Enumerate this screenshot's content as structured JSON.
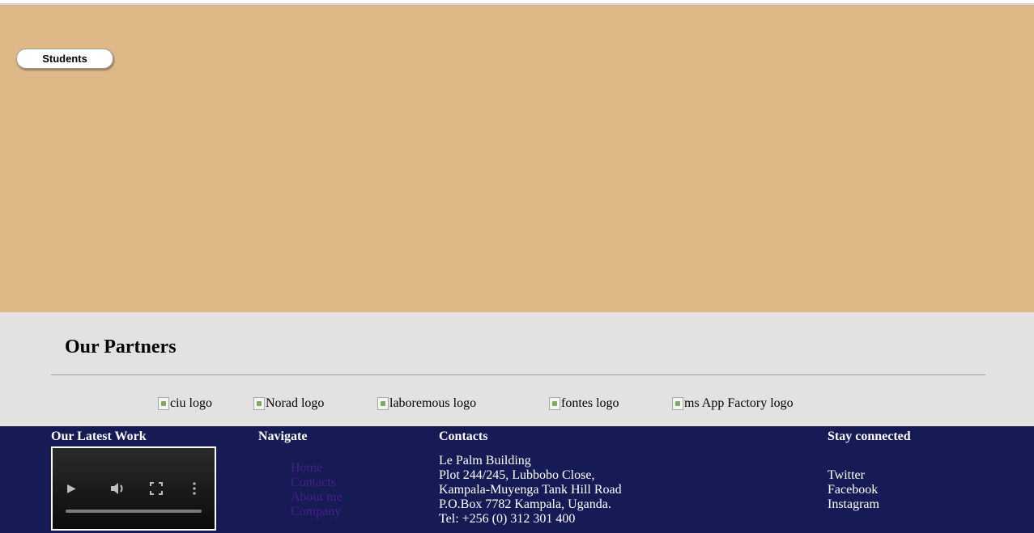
{
  "hero": {
    "students_button": "Students",
    "background_color": "#deb887"
  },
  "partners": {
    "title": "Our Partners",
    "logos": [
      {
        "alt": "ciu logo"
      },
      {
        "alt": "Norad logo"
      },
      {
        "alt": "laboremous logo"
      },
      {
        "alt": "fontes logo"
      },
      {
        "alt": "ms App Factory logo"
      }
    ]
  },
  "footer": {
    "background_color": "#161b56",
    "latest_work": {
      "title": "Our Latest Work"
    },
    "navigate": {
      "title": "Navigate",
      "links": [
        "Home",
        "Contacts",
        "About me",
        "Company"
      ],
      "link_color": "#4b1e86"
    },
    "contacts": {
      "title": "Contacts",
      "lines": [
        "Le Palm Building",
        "Plot 244/245, Lubbobo Close,",
        "Kampala-Muyenga Tank Hill Road",
        "P.O.Box 7782 Kampala, Uganda.",
        "Tel: +256 (0) 312 301 400"
      ]
    },
    "social": {
      "title": "Stay connected",
      "links": [
        "Twitter",
        "Facebook",
        "Instagram"
      ]
    }
  }
}
